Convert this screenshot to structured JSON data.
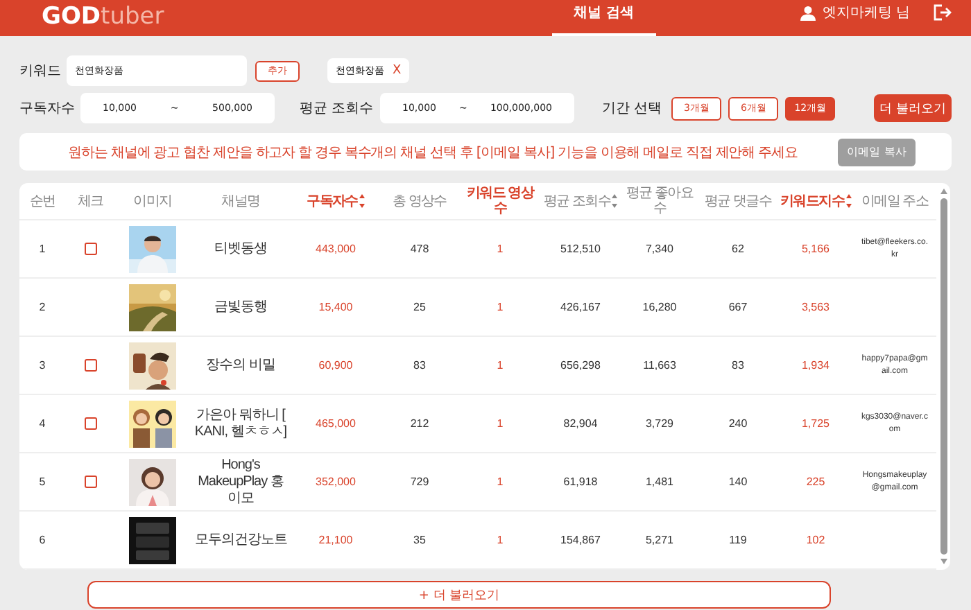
{
  "header": {
    "logo": {
      "main": "GOD",
      "light": "tuber"
    },
    "nav": [
      {
        "label": "채널 검색",
        "selected": true
      }
    ],
    "user": "엣지마케팅 님"
  },
  "filters": {
    "keyword": {
      "label": "키워드",
      "value": "천연화장품",
      "add_button": "추가",
      "tags": [
        {
          "label": "천연화장품",
          "remove": "X"
        }
      ]
    },
    "subscribers": {
      "label": "구독자수",
      "min": "10,000",
      "separator": "~",
      "max": "500,000"
    },
    "avg_views": {
      "label": "평균 조회수",
      "min": "10,000",
      "separator": "~",
      "max": "100,000,000"
    },
    "period": {
      "label": "기간 선택",
      "options": [
        {
          "label": "3개월",
          "selected": false
        },
        {
          "label": "6개월",
          "selected": false
        },
        {
          "label": "12개월",
          "selected": true
        }
      ]
    },
    "load_button": "더 불러오기"
  },
  "notice": {
    "text": "원하는 채널에 광고 협찬 제안을 하고자 할 경우 복수개의 채널 선택 후 [이메일 복사] 기능을 이용해 메일로 직접 제안해 주세요",
    "button": {
      "label": "이메일 복사",
      "disabled": true
    }
  },
  "table": {
    "columns": [
      {
        "label": "순번",
        "highlighted": false,
        "sortable": false
      },
      {
        "label": "체크",
        "highlighted": false,
        "sortable": false
      },
      {
        "label": "이미지",
        "highlighted": false,
        "sortable": false
      },
      {
        "label": "채널명",
        "highlighted": false,
        "sortable": false
      },
      {
        "label": "구독자수",
        "highlighted": true,
        "sortable": true
      },
      {
        "label": "총 영상수",
        "highlighted": false,
        "sortable": false
      },
      {
        "label": "키워드 영상 수",
        "highlighted": true,
        "sortable": false
      },
      {
        "label": "평균 조회수",
        "highlighted": false,
        "sortable": true
      },
      {
        "label": "평균 좋아요 수",
        "highlighted": false,
        "sortable": false
      },
      {
        "label": "평균 댓글수",
        "highlighted": false,
        "sortable": false
      },
      {
        "label": "키워드지수",
        "highlighted": true,
        "sortable": true
      },
      {
        "label": "이메일 주소",
        "highlighted": false,
        "sortable": false
      }
    ],
    "rows": [
      {
        "no": "1",
        "checked": false,
        "name": "티벳동생",
        "subscribers": "443,000",
        "videos": "478",
        "keyword_videos": "1",
        "avg_views": "512,510",
        "avg_likes": "7,340",
        "avg_comments": "62",
        "keyword_index": "5,166",
        "email": "tibet@fleekers.co.kr"
      },
      {
        "no": "2",
        "name": "금빛동행",
        "subscribers": "15,400",
        "videos": "25",
        "keyword_videos": "1",
        "avg_views": "426,167",
        "avg_likes": "16,280",
        "avg_comments": "667",
        "keyword_index": "3,563"
      },
      {
        "no": "3",
        "checked": false,
        "name": "장수의 비밀",
        "subscribers": "60,900",
        "videos": "83",
        "keyword_videos": "1",
        "avg_views": "656,298",
        "avg_likes": "11,663",
        "avg_comments": "83",
        "keyword_index": "1,934",
        "email": "happy7papa@gmail.com"
      },
      {
        "no": "4",
        "checked": false,
        "name": "가은아 뭐하니 [ KANI, 헬ㅊㅎㅅ]",
        "subscribers": "465,000",
        "videos": "212",
        "keyword_videos": "1",
        "avg_views": "82,904",
        "avg_likes": "3,729",
        "avg_comments": "240",
        "keyword_index": "1,725",
        "email": "kgs3030@naver.com"
      },
      {
        "no": "5",
        "checked": false,
        "name": "Hong's MakeupPlay 홍이모",
        "subscribers": "352,000",
        "videos": "729",
        "keyword_videos": "1",
        "avg_views": "61,918",
        "avg_likes": "1,481",
        "avg_comments": "140",
        "keyword_index": "225",
        "email": "Hongsmakeuplay@gmail.com"
      },
      {
        "no": "6",
        "name": "모두의건강노트",
        "subscribers": "21,100",
        "videos": "35",
        "keyword_videos": "1",
        "avg_views": "154,867",
        "avg_likes": "5,271",
        "avg_comments": "119",
        "keyword_index": "102"
      }
    ]
  },
  "more_button": "+ 더 불러오기"
}
